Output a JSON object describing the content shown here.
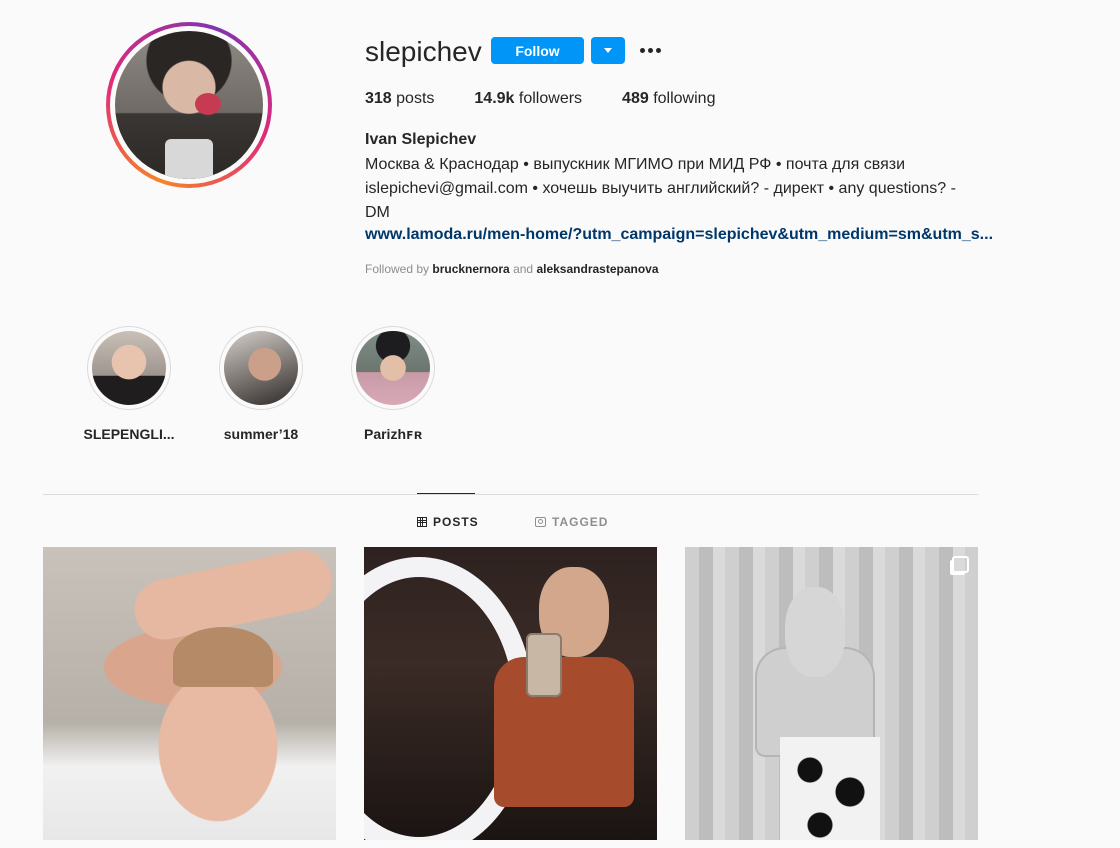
{
  "profile": {
    "username": "slepichev",
    "follow_label": "Follow",
    "stats": {
      "posts_count": "318",
      "posts_label": "posts",
      "followers_count": "14.9k",
      "followers_label": "followers",
      "following_count": "489",
      "following_label": "following"
    },
    "full_name": "Ivan Slepichev",
    "bio_lines": [
      "Москва & Краснодар • выпускник МГИМО при МИД РФ • почта для связи",
      "islepichevi@gmail.com • хочешь выучить английский? - директ • any questions? -",
      "DM"
    ],
    "link": "www.lamoda.ru/men-home/?utm_campaign=slepichev&utm_medium=sm&utm_s...",
    "followed_by": {
      "prefix": "Followed by",
      "user1": "brucknernora",
      "joiner": "and",
      "user2": "aleksandrastepanova"
    }
  },
  "highlights": [
    {
      "label": "SLEPENGLI..."
    },
    {
      "label": "summer’18"
    },
    {
      "label": "Parizhꜰʀ"
    }
  ],
  "tabs": {
    "posts": "POSTS",
    "tagged": "TAGGED",
    "active": "posts"
  },
  "colors": {
    "accent": "#0095f6",
    "link": "#00376b",
    "muted": "#8e8e8e",
    "text": "#262626"
  },
  "icons": {
    "more": "more-options-icon",
    "dropdown": "chevron-down-icon",
    "posts_tab": "grid-icon",
    "tagged_tab": "tagged-icon",
    "multi": "carousel-icon"
  }
}
